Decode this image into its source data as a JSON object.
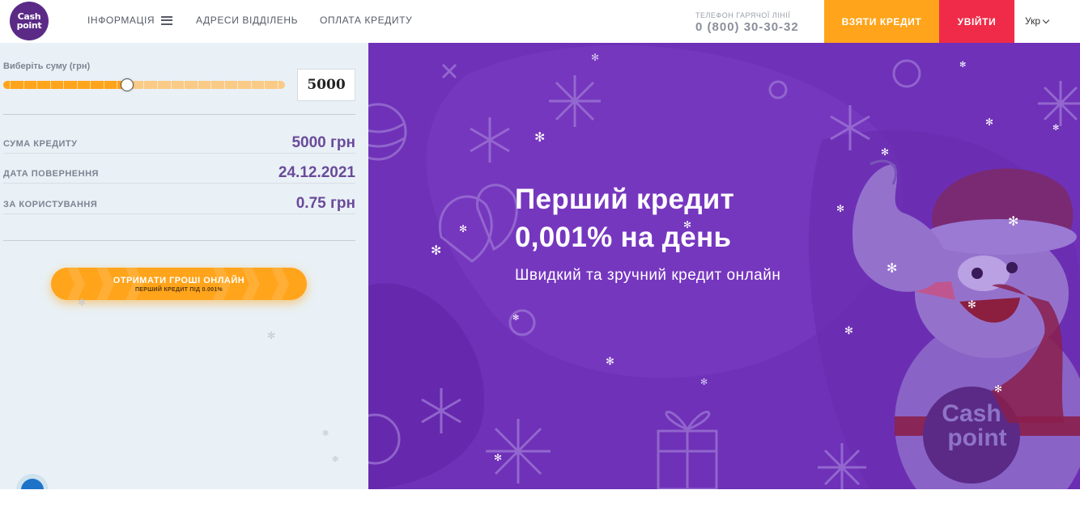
{
  "header": {
    "logo_line1": "Cash",
    "logo_line2": "point",
    "nav_info": "ІНФОРМАЦІЯ",
    "nav_addresses": "АДРЕСИ ВІДДІЛЕНЬ",
    "nav_payment": "ОПЛАТА КРЕДИТУ",
    "hotline_label": "ТЕЛЕФОН ГАРЯЧОЇ ЛІНІЇ",
    "hotline_number": "0 (800) 30-30-32",
    "take_credit": "ВЗЯТИ КРЕДИТ",
    "login": "УВІЙТИ",
    "language": "Укр"
  },
  "calculator": {
    "select_label": "Виберіть суму (грн)",
    "amount_value": "5000",
    "slider_fraction": 0.44,
    "rows": [
      {
        "label": "СУМА КРЕДИТУ",
        "value": "5000 грн"
      },
      {
        "label": "ДАТА ПОВЕРНЕННЯ",
        "value": "24.12.2021"
      },
      {
        "label": "ЗА КОРИСТУВАННЯ",
        "value": "0.75 грн"
      }
    ],
    "cta_title": "ОТРИМАТИ ГРОШІ ОНЛАЙН",
    "cta_subtitle": "ПЕРШИЙ КРЕДИТ ПІД 0.001%"
  },
  "banner": {
    "title_line1": "Перший кредит",
    "title_line2": "0,001% на день",
    "subtitle": "Швидкий та зручний кредит онлайн",
    "mascot_logo_line1": "Cash",
    "mascot_logo_line2": "point"
  },
  "icons": {
    "menu": "hamburger-icon",
    "language_dropdown": "chevron-down-icon",
    "chat": "chat-bubble-icon"
  },
  "colors": {
    "brand_purple": "#6e31b8",
    "accent_orange": "#ffa41b",
    "accent_red": "#ef2b49",
    "value_purple": "#6a4a9a"
  }
}
